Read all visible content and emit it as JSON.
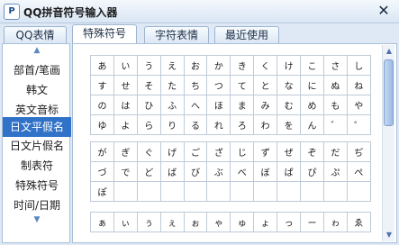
{
  "window": {
    "title": "QQ拼音符号输入器",
    "icon": "P",
    "close_label": "✕"
  },
  "tabs": [
    {
      "label": "QQ表情"
    },
    {
      "label": "特殊符号"
    },
    {
      "label": "字符表情"
    },
    {
      "label": "最近使用"
    }
  ],
  "active_tab": "特殊符号",
  "sidebar": {
    "up_arrow": "▲",
    "down_arrow": "▼",
    "items": [
      {
        "label": "部首/笔画"
      },
      {
        "label": "韩文"
      },
      {
        "label": "英文音标"
      },
      {
        "label": "日文平假名"
      },
      {
        "label": "日文片假名"
      },
      {
        "label": "制表符"
      },
      {
        "label": "特殊符号"
      },
      {
        "label": "时间/日期"
      }
    ],
    "selected": "日文平假名"
  },
  "symbol_groups": [
    {
      "rows": [
        [
          "あ",
          "い",
          "う",
          "え",
          "お",
          "か",
          "き",
          "く",
          "け",
          "こ",
          "さ",
          "し"
        ],
        [
          "す",
          "せ",
          "そ",
          "た",
          "ち",
          "つ",
          "て",
          "と",
          "な",
          "に",
          "ぬ",
          "ね"
        ],
        [
          "の",
          "は",
          "ひ",
          "ふ",
          "へ",
          "ほ",
          "ま",
          "み",
          "む",
          "め",
          "も",
          "や"
        ],
        [
          "ゆ",
          "よ",
          "ら",
          "り",
          "る",
          "れ",
          "ろ",
          "わ",
          "を",
          "ん",
          "゛",
          "゜"
        ]
      ]
    },
    {
      "rows": [
        [
          "が",
          "ぎ",
          "ぐ",
          "げ",
          "ご",
          "ざ",
          "じ",
          "ず",
          "ぜ",
          "ぞ",
          "だ",
          "ぢ"
        ],
        [
          "づ",
          "で",
          "ど",
          "ば",
          "び",
          "ぶ",
          "べ",
          "ぼ",
          "ぱ",
          "ぴ",
          "ぷ",
          "ぺ"
        ],
        [
          "ぽ",
          "",
          "",
          "",
          "",
          "",
          "",
          "",
          "",
          "",
          "",
          ""
        ]
      ]
    },
    {
      "rows": [
        [
          "ぁ",
          "ぃ",
          "ぅ",
          "ぇ",
          "ぉ",
          "ゃ",
          "ゅ",
          "ょ",
          "っ",
          "ー",
          "ゎ",
          "ゑ"
        ]
      ]
    }
  ],
  "scrollbar": {
    "up_arrow": "▲",
    "down_arrow": "▼"
  }
}
